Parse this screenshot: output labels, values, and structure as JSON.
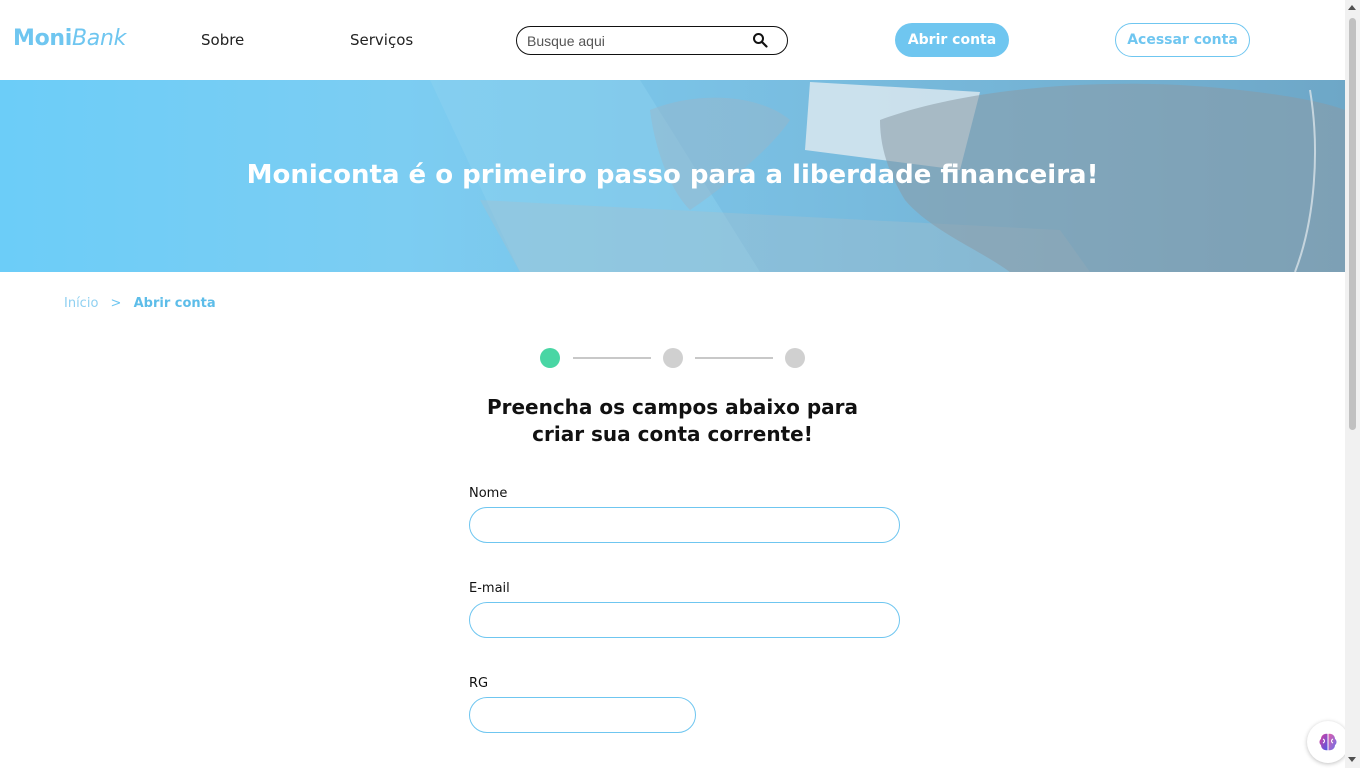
{
  "header": {
    "logo": {
      "part1": "Moni",
      "part2": "Bank"
    },
    "nav": {
      "sobre": "Sobre",
      "servicos": "Serviços"
    },
    "search": {
      "placeholder": "Busque aqui",
      "value": ""
    },
    "btn_open_account": "Abrir conta",
    "btn_access_account": "Acessar conta"
  },
  "banner": {
    "title": "Moniconta é o primeiro passo para a liberdade financeira!"
  },
  "breadcrumb": {
    "home": "Início",
    "separator": ">",
    "current": "Abrir conta"
  },
  "stepper": {
    "current_step": 1,
    "total_steps": 3
  },
  "form": {
    "title_line1": "Preencha os campos abaixo para",
    "title_line2": "criar sua conta corrente!",
    "fields": {
      "nome": {
        "label": "Nome",
        "value": ""
      },
      "email": {
        "label": "E-mail",
        "value": ""
      },
      "rg": {
        "label": "RG",
        "value": ""
      }
    }
  },
  "colors": {
    "brand": "#6fc6f0",
    "step_active": "#49d6a4",
    "step_inactive": "#d0d0d0"
  },
  "icons": {
    "search": "search-icon",
    "assistant": "brain-icon"
  }
}
